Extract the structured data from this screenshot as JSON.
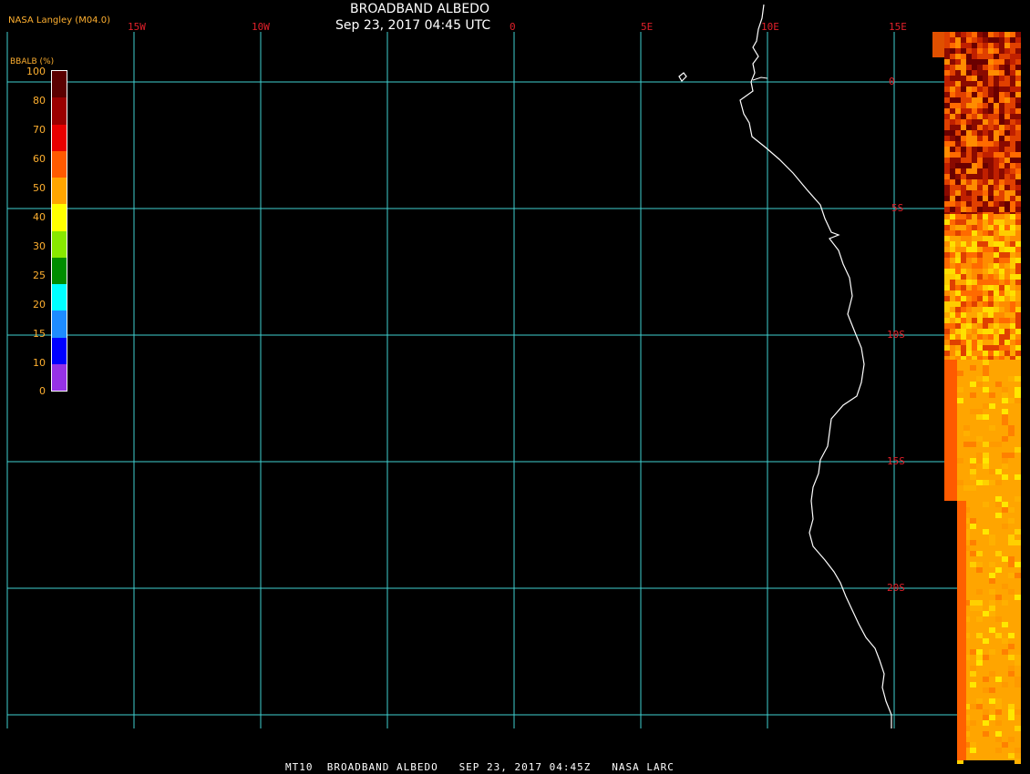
{
  "header": {
    "title": "BROADBAND ALBEDO",
    "datetime": "Sep 23, 2017 04:45 UTC",
    "credit": "NASA Langley (M04.0)"
  },
  "footer": {
    "caption": "MT10  BROADBAND ALBEDO   SEP 23, 2017 04:45Z   NASA LARC"
  },
  "map": {
    "lon_labels": [
      "15W",
      "10W",
      "0",
      "5E",
      "10E",
      "15E"
    ],
    "lat_labels": [
      "0",
      "5S",
      "10S",
      "15S",
      "20S"
    ],
    "grid_color": "#40d0d0",
    "label_color": "#e0202a",
    "coastline_color": "#ffffff"
  },
  "colorbar": {
    "title": "BBALB (%)",
    "ticks": [
      "100",
      "80",
      "70",
      "60",
      "50",
      "40",
      "30",
      "25",
      "20",
      "15",
      "10",
      "0"
    ],
    "colors": [
      "#5a0000",
      "#9a0000",
      "#e80000",
      "#ff5a00",
      "#ffa500",
      "#ffff00",
      "#88e800",
      "#008c00",
      "#00ffff",
      "#1e8cff",
      "#0000ff",
      "#9632e6"
    ]
  }
}
